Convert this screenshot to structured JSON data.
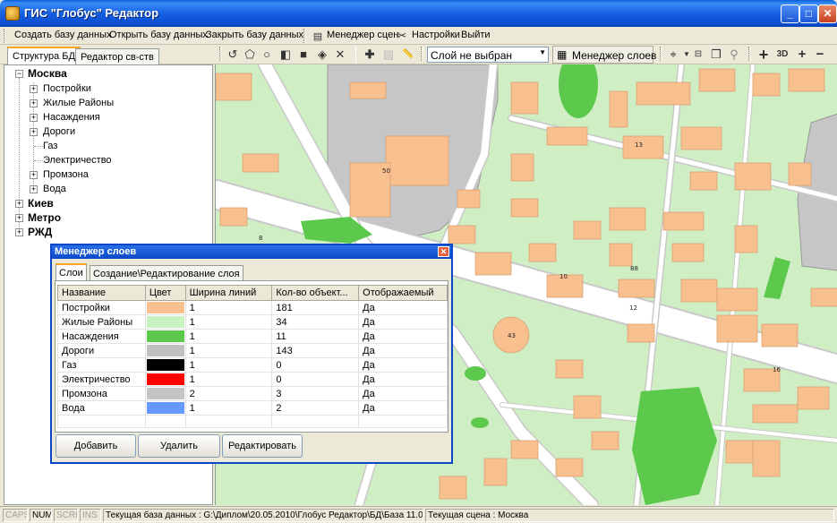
{
  "window": {
    "title": "ГИС \"Глобус\" Редактор",
    "min": "_",
    "max": "□",
    "close": "✕"
  },
  "menu": [
    {
      "label": "Создать базу данных"
    },
    {
      "label": "Открыть базу данных"
    },
    {
      "label": "Закрыть базу данных"
    },
    {
      "label": "Менеджер сцен"
    },
    {
      "label": "Настройки"
    },
    {
      "label": "Выйти"
    }
  ],
  "toolbar": {
    "layer_select_value": "Слой не выбран",
    "layer_manager_label": "Менеджер слоев",
    "btn_3d": "3D",
    "plus": "+",
    "minus": "−"
  },
  "left_tabs": [
    "Структура БД",
    "Редактор св-ств"
  ],
  "tree": {
    "root1": "Москва",
    "children": [
      "Постройки",
      "Жилые Районы",
      "Насаждения",
      "Дороги",
      "Газ",
      "Электричество",
      "Промзона",
      "Вода"
    ],
    "root2": "Киев",
    "root3": "Метро",
    "root4": "РЖД"
  },
  "map_labels": [
    "50",
    "13",
    "8",
    "10",
    "88",
    "12",
    "43",
    "16"
  ],
  "dialog": {
    "title": "Менеджер слоев",
    "tabs": [
      "Слои",
      "Создание\\Редактирование слоя"
    ],
    "columns": [
      "Название",
      "Цвет",
      "Ширина линий",
      "Кол-во объект...",
      "Отображаемый"
    ],
    "rows": [
      {
        "name": "Постройки",
        "color": "#f9c08f",
        "width": "1",
        "count": "181",
        "visible": "Да"
      },
      {
        "name": "Жилые Районы",
        "color": "#c8f2c0",
        "width": "1",
        "count": "34",
        "visible": "Да"
      },
      {
        "name": "Насаждения",
        "color": "#5cc84c",
        "width": "1",
        "count": "11",
        "visible": "Да"
      },
      {
        "name": "Дороги",
        "color": "#c0c0c0",
        "width": "1",
        "count": "143",
        "visible": "Да"
      },
      {
        "name": "Газ",
        "color": "#000000",
        "width": "1",
        "count": "0",
        "visible": "Да"
      },
      {
        "name": "Электричество",
        "color": "#ff0000",
        "width": "1",
        "count": "0",
        "visible": "Да"
      },
      {
        "name": "Промзона",
        "color": "#c4c4c4",
        "width": "2",
        "count": "3",
        "visible": "Да"
      },
      {
        "name": "Вода",
        "color": "#6699ff",
        "width": "1",
        "count": "2",
        "visible": "Да"
      }
    ],
    "buttons": {
      "add": "Добавить",
      "delete": "Удалить",
      "edit": "Редактировать"
    }
  },
  "status": {
    "caps": "CAPS",
    "num": "NUM",
    "scrl": "SCRL",
    "ins": "INS",
    "db": "Текущая база данных : G:\\Диплом\\20.05.2010\\Глобус Редактор\\БД\\База 11.0",
    "scene": "Текущая сцена : Москва"
  }
}
